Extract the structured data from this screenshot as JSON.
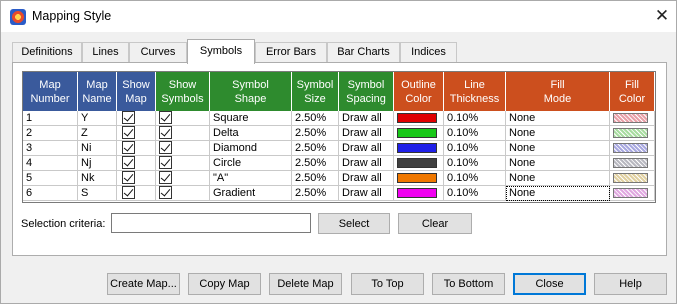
{
  "window": {
    "title": "Mapping Style"
  },
  "tabs": [
    {
      "label": "Definitions"
    },
    {
      "label": "Lines"
    },
    {
      "label": "Curves"
    },
    {
      "label": "Symbols"
    },
    {
      "label": "Error Bars"
    },
    {
      "label": "Bar Charts"
    },
    {
      "label": "Indices"
    }
  ],
  "active_tab": "Symbols",
  "columns": [
    {
      "label": "Map\nNumber",
      "color": "#3a5a9c"
    },
    {
      "label": "Map\nName",
      "color": "#3a5a9c"
    },
    {
      "label": "Show\nMap",
      "color": "#3a5a9c"
    },
    {
      "label": "Show\nSymbols",
      "color": "#2e8b2e"
    },
    {
      "label": "Symbol\nShape",
      "color": "#2e8b2e"
    },
    {
      "label": "Symbol\nSize",
      "color": "#2e8b2e"
    },
    {
      "label": "Symbol\nSpacing",
      "color": "#2e8b2e"
    },
    {
      "label": "Outline\nColor",
      "color": "#cc4f1e"
    },
    {
      "label": "Line\nThickness",
      "color": "#cc4f1e"
    },
    {
      "label": "Fill\nMode",
      "color": "#cc4f1e"
    },
    {
      "label": "Fill\nColor",
      "color": "#cc4f1e"
    }
  ],
  "rows": [
    {
      "number": "1",
      "name": "Y",
      "show_map": true,
      "show_symbols": true,
      "shape": "Square",
      "size": "2.50%",
      "spacing": "Draw all",
      "outline_color": "#e00000",
      "thickness": "0.10%",
      "fill_mode": "None",
      "fill_color": "#e8a0a8"
    },
    {
      "number": "2",
      "name": "Z",
      "show_map": true,
      "show_symbols": true,
      "shape": "Delta",
      "size": "2.50%",
      "spacing": "Draw all",
      "outline_color": "#18c818",
      "thickness": "0.10%",
      "fill_mode": "None",
      "fill_color": "#a8dca0"
    },
    {
      "number": "3",
      "name": "Ni",
      "show_map": true,
      "show_symbols": true,
      "shape": "Diamond",
      "size": "2.50%",
      "spacing": "Draw all",
      "outline_color": "#2020e8",
      "thickness": "0.10%",
      "fill_mode": "None",
      "fill_color": "#a8a8e0"
    },
    {
      "number": "4",
      "name": "Nj",
      "show_map": true,
      "show_symbols": true,
      "shape": "Circle",
      "size": "2.50%",
      "spacing": "Draw all",
      "outline_color": "#404040",
      "thickness": "0.10%",
      "fill_mode": "None",
      "fill_color": "#b8b8c0"
    },
    {
      "number": "5",
      "name": "Nk",
      "show_map": true,
      "show_symbols": true,
      "shape": "\"A\"",
      "size": "2.50%",
      "spacing": "Draw all",
      "outline_color": "#f07800",
      "thickness": "0.10%",
      "fill_mode": "None",
      "fill_color": "#e0d0a0"
    },
    {
      "number": "6",
      "name": "S",
      "show_map": true,
      "show_symbols": true,
      "shape": "Gradient",
      "size": "2.50%",
      "spacing": "Draw all",
      "outline_color": "#f000f0",
      "thickness": "0.10%",
      "fill_mode": "None",
      "fill_color": "#e0a8e0"
    }
  ],
  "selection": {
    "label": "Selection criteria:",
    "value": "",
    "select_label": "Select",
    "clear_label": "Clear"
  },
  "footer_buttons": [
    {
      "label": "Create Map..."
    },
    {
      "label": "Copy Map"
    },
    {
      "label": "Delete Map"
    },
    {
      "label": "To Top"
    },
    {
      "label": "To Bottom"
    },
    {
      "label": "Close"
    },
    {
      "label": "Help"
    }
  ]
}
